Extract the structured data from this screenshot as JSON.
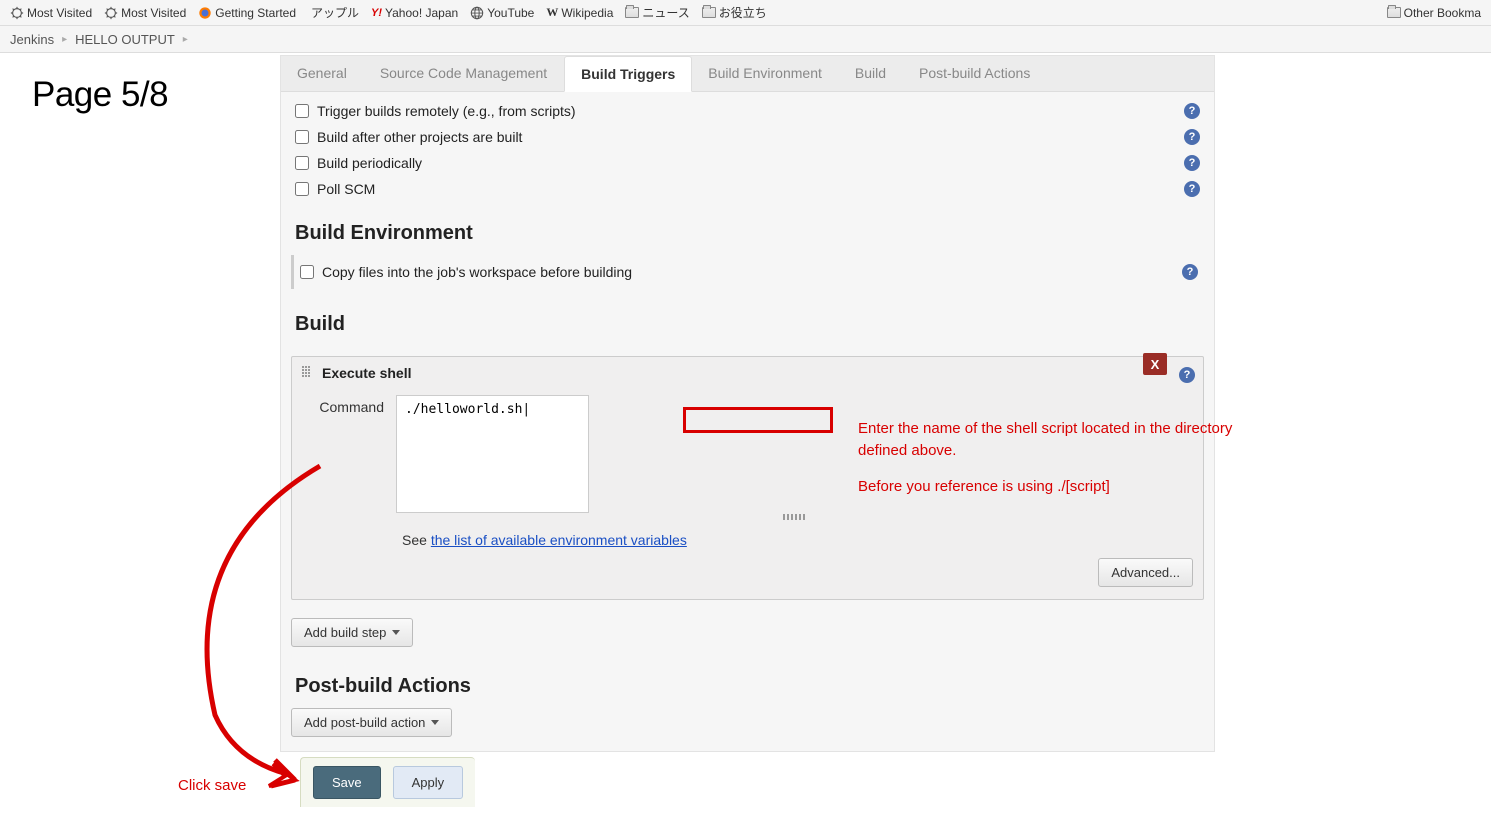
{
  "bookmarks": {
    "b0": "Most Visited",
    "b1": "Most Visited",
    "b2": "Getting Started",
    "b3": "アップル",
    "b4": "Yahoo! Japan",
    "b5": "YouTube",
    "b6": "Wikipedia",
    "b7": "ニュース",
    "b8": "お役立ち",
    "other": "Other Bookma"
  },
  "breadcrumb": {
    "root": "Jenkins",
    "job": "HELLO OUTPUT"
  },
  "page_label": "Page 5/8",
  "tabs": {
    "general": "General",
    "scm": "Source Code Management",
    "triggers": "Build Triggers",
    "env": "Build Environment",
    "build": "Build",
    "post": "Post-build Actions"
  },
  "triggers": {
    "remote": "Trigger builds remotely (e.g., from scripts)",
    "after": "Build after other projects are built",
    "periodic": "Build periodically",
    "poll": "Poll SCM"
  },
  "sections": {
    "env": "Build Environment",
    "build": "Build",
    "post": "Post-build Actions"
  },
  "env": {
    "copy": "Copy files into the job's workspace before building"
  },
  "buildstep": {
    "title": "Execute shell",
    "cmd_label": "Command",
    "cmd_value": "./helloworld.sh|",
    "see": "See ",
    "see_link": "the list of available environment variables",
    "advanced": "Advanced...",
    "close": "X"
  },
  "buttons": {
    "add_step": "Add build step",
    "add_post": "Add post-build action",
    "save": "Save",
    "apply": "Apply"
  },
  "annotations": {
    "a1": "Enter the name of the shell script located in the directory defined above.",
    "a2": "Before you reference is using ./[script]",
    "click_save": "Click save"
  }
}
